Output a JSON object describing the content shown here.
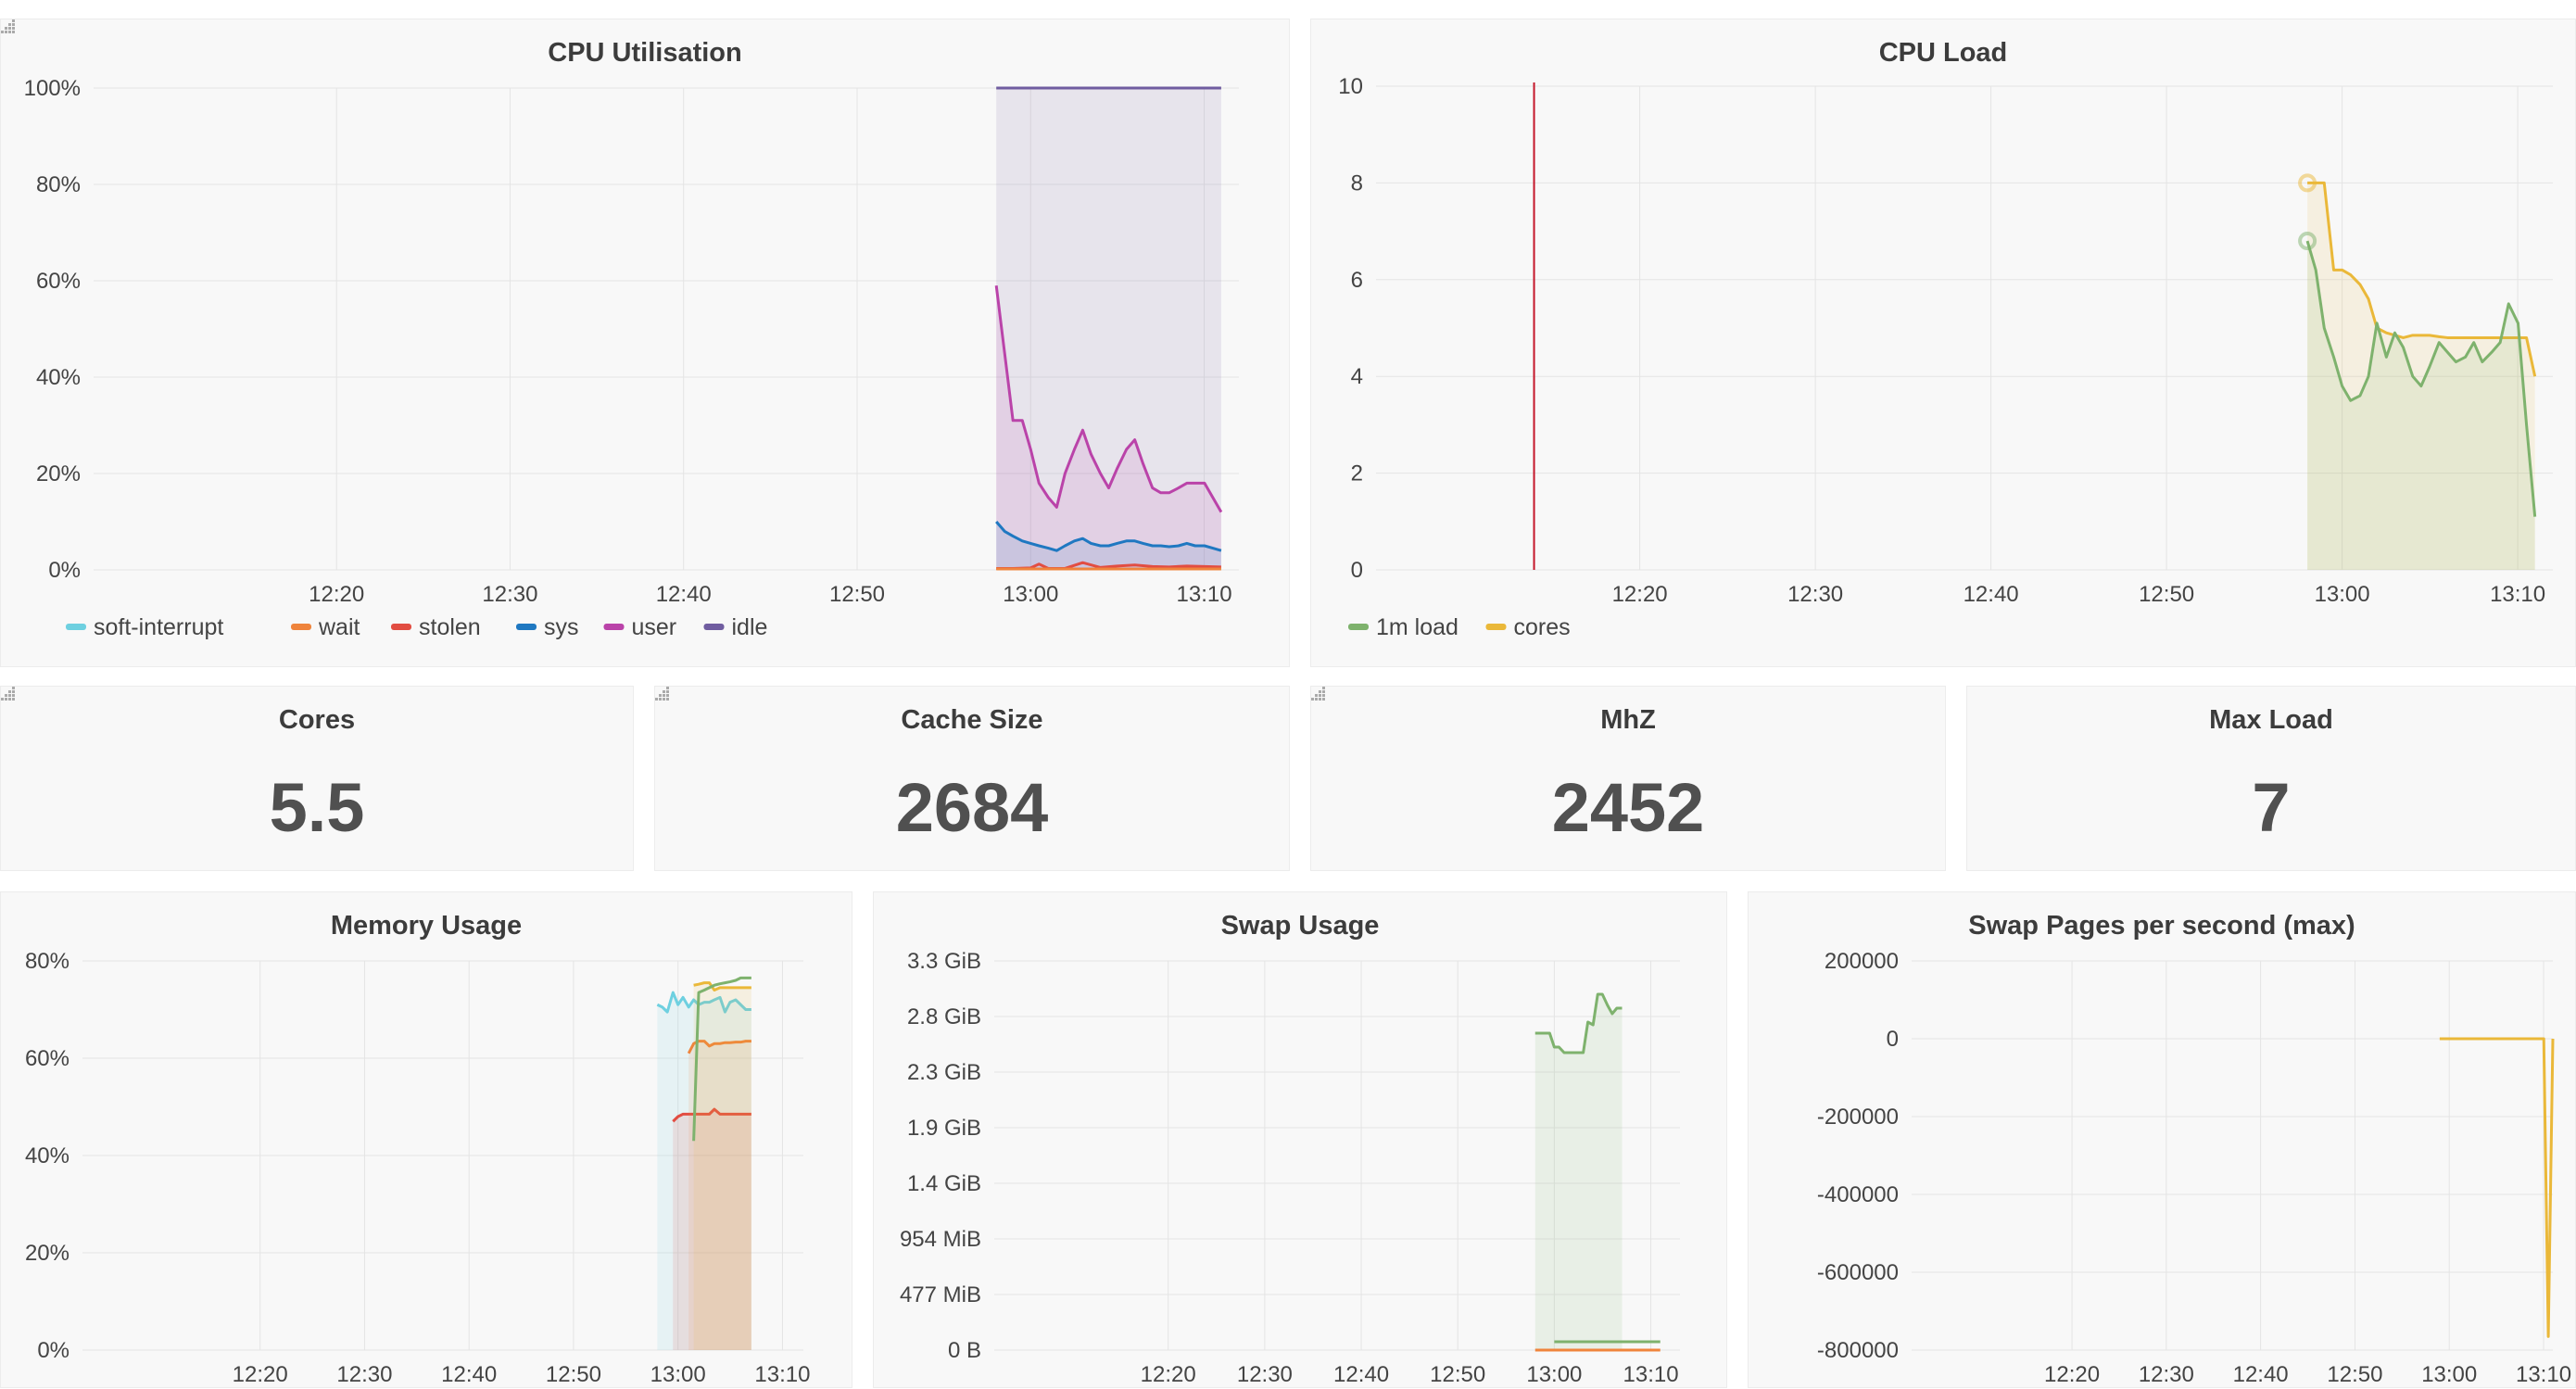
{
  "colors": {
    "soft_interrupt": "#6ed0e0",
    "wait": "#ef843c",
    "stolen": "#e24d42",
    "sys": "#1f78c1",
    "user": "#ba43a9",
    "idle": "#705da0",
    "load": "#7eb26d",
    "cores": "#eab839",
    "mem_cyan": "#6ed0e0",
    "mem_orange": "#ef843c",
    "mem_red": "#e24d42",
    "mem_yellow": "#eab839",
    "mem_green": "#7eb26d",
    "swap_green": "#7eb26d",
    "swap_orange": "#ef843c",
    "threshold_red": "#c4162a"
  },
  "panels": {
    "cpu_util": {
      "title": "CPU Utilisation"
    },
    "cpu_load": {
      "title": "CPU Load"
    },
    "cores": {
      "title": "Cores",
      "value": "5.5"
    },
    "cache": {
      "title": "Cache Size",
      "value": "2684"
    },
    "mhz": {
      "title": "MhZ",
      "value": "2452"
    },
    "maxload": {
      "title": "Max Load",
      "value": "7"
    },
    "memory": {
      "title": "Memory Usage"
    },
    "swap": {
      "title": "Swap Usage"
    },
    "swap_pages": {
      "title": "Swap Pages per second (max)"
    }
  },
  "chart_data": [
    {
      "id": "cpu_util",
      "type": "area",
      "title": "CPU Utilisation",
      "x_ticks": [
        "12:20",
        "12:30",
        "12:40",
        "12:50",
        "13:00",
        "13:10"
      ],
      "x_range": [
        12.1,
        13.2
      ],
      "y_ticks": [
        "0%",
        "20%",
        "40%",
        "60%",
        "80%",
        "100%"
      ],
      "ylim": [
        0,
        100
      ],
      "legend": [
        "soft-interrupt",
        "wait",
        "stolen",
        "sys",
        "user",
        "idle"
      ],
      "legend_position": "bottom-left",
      "grid": true,
      "series": [
        {
          "name": "idle",
          "color_key": "idle",
          "fill": true,
          "x": [
            12.967,
            13.183
          ],
          "values": [
            100,
            100
          ]
        },
        {
          "name": "user",
          "color_key": "user",
          "fill": true,
          "x": [
            12.967,
            12.975,
            12.983,
            12.992,
            13.0,
            13.008,
            13.017,
            13.025,
            13.033,
            13.042,
            13.05,
            13.058,
            13.067,
            13.075,
            13.083,
            13.092,
            13.1,
            13.108,
            13.117,
            13.125,
            13.133,
            13.142,
            13.15,
            13.158,
            13.167,
            13.175,
            13.183
          ],
          "values": [
            59,
            45,
            31,
            31,
            25,
            18,
            15,
            13,
            20,
            25,
            29,
            24,
            20,
            17,
            21,
            25,
            27,
            22,
            17,
            16,
            16,
            17,
            18,
            18,
            18,
            15,
            12
          ]
        },
        {
          "name": "sys",
          "color_key": "sys",
          "fill": true,
          "x": [
            12.967,
            12.975,
            12.983,
            12.992,
            13.0,
            13.008,
            13.017,
            13.025,
            13.033,
            13.042,
            13.05,
            13.058,
            13.067,
            13.075,
            13.083,
            13.092,
            13.1,
            13.108,
            13.117,
            13.125,
            13.133,
            13.142,
            13.15,
            13.158,
            13.167,
            13.175,
            13.183
          ],
          "values": [
            10,
            8,
            7,
            6,
            5.5,
            5,
            4.5,
            4,
            5,
            6,
            6.5,
            5.5,
            5,
            5,
            5.5,
            6,
            6,
            5.5,
            5,
            5,
            4.8,
            5,
            5.5,
            5,
            5,
            4.5,
            4
          ]
        },
        {
          "name": "stolen",
          "color_key": "stolen",
          "fill": false,
          "x": [
            12.967,
            12.983,
            13.0,
            13.008,
            13.017,
            13.033,
            13.05,
            13.067,
            13.083,
            13.1,
            13.117,
            13.133,
            13.15,
            13.167,
            13.183
          ],
          "values": [
            0.3,
            0.3,
            0.4,
            1.2,
            0.3,
            0.3,
            1.5,
            0.5,
            0.8,
            1.0,
            0.7,
            0.6,
            0.8,
            0.7,
            0.6
          ]
        },
        {
          "name": "wait",
          "color_key": "wait",
          "fill": false,
          "x": [
            12.967,
            13.183
          ],
          "values": [
            0.2,
            0.2
          ]
        }
      ]
    },
    {
      "id": "cpu_load",
      "type": "line",
      "title": "CPU Load",
      "x_ticks": [
        "12:20",
        "12:30",
        "12:40",
        "12:50",
        "13:00",
        "13:10"
      ],
      "x_range": [
        12.083,
        13.2
      ],
      "y_ticks": [
        "0",
        "2",
        "4",
        "6",
        "8",
        "10"
      ],
      "ylim": [
        0,
        10
      ],
      "legend": [
        "1m load",
        "cores"
      ],
      "legend_position": "bottom-left",
      "grid": true,
      "annotation_x": 12.233,
      "series": [
        {
          "name": "cores",
          "color_key": "cores",
          "fill": true,
          "x": [
            12.967,
            12.975,
            12.983,
            12.992,
            13.0,
            13.008,
            13.017,
            13.025,
            13.033,
            13.042,
            13.05,
            13.058,
            13.067,
            13.075,
            13.083,
            13.092,
            13.1,
            13.108,
            13.117,
            13.125,
            13.133,
            13.142,
            13.15,
            13.158,
            13.167,
            13.175,
            13.183
          ],
          "values": [
            8,
            8,
            8,
            6.2,
            6.2,
            6.1,
            5.9,
            5.6,
            5.0,
            4.9,
            4.85,
            4.8,
            4.85,
            4.85,
            4.85,
            4.82,
            4.8,
            4.8,
            4.8,
            4.8,
            4.8,
            4.8,
            4.8,
            4.8,
            4.8,
            4.8,
            4.0
          ]
        },
        {
          "name": "1m load",
          "color_key": "load",
          "fill": true,
          "x": [
            12.967,
            12.975,
            12.983,
            12.992,
            13.0,
            13.008,
            13.017,
            13.025,
            13.033,
            13.042,
            13.05,
            13.058,
            13.067,
            13.075,
            13.083,
            13.092,
            13.1,
            13.108,
            13.117,
            13.125,
            13.133,
            13.142,
            13.15,
            13.158,
            13.167,
            13.175,
            13.183
          ],
          "values": [
            6.8,
            6.2,
            5.0,
            4.4,
            3.8,
            3.5,
            3.6,
            4.0,
            5.1,
            4.4,
            4.9,
            4.6,
            4.0,
            3.8,
            4.2,
            4.7,
            4.5,
            4.3,
            4.4,
            4.7,
            4.3,
            4.5,
            4.7,
            5.5,
            5.1,
            3.0,
            1.1
          ]
        }
      ]
    },
    {
      "id": "memory",
      "type": "area",
      "title": "Memory Usage",
      "x_ticks": [
        "12:20",
        "12:30",
        "12:40",
        "12:50",
        "13:00",
        "13:10"
      ],
      "x_range": [
        12.05,
        13.2
      ],
      "y_ticks": [
        "0%",
        "20%",
        "40%",
        "60%",
        "80%"
      ],
      "ylim": [
        0,
        80
      ],
      "grid": true,
      "series": [
        {
          "color_key": "mem_cyan",
          "fill": true,
          "x": [
            12.967,
            12.975,
            12.983,
            12.992,
            13.0,
            13.008,
            13.017,
            13.025,
            13.033,
            13.042,
            13.05,
            13.058,
            13.067,
            13.075,
            13.083,
            13.092,
            13.1,
            13.108,
            13.117
          ],
          "values": [
            71,
            70.5,
            69.5,
            73.5,
            71,
            72.5,
            70.5,
            72,
            71,
            71.5,
            71.5,
            72,
            72.5,
            69.5,
            71.5,
            72,
            71,
            70,
            70
          ]
        },
        {
          "color_key": "mem_red",
          "fill": true,
          "x": [
            12.992,
            13.0,
            13.008,
            13.017,
            13.025,
            13.033,
            13.042,
            13.05,
            13.058,
            13.067,
            13.075,
            13.083,
            13.092,
            13.1,
            13.108,
            13.117
          ],
          "values": [
            47,
            48,
            48.5,
            48.5,
            48.5,
            48.5,
            48.5,
            48.5,
            49.5,
            48.5,
            48.5,
            48.5,
            48.5,
            48.5,
            48.5,
            48.5
          ]
        },
        {
          "color_key": "mem_orange",
          "fill": true,
          "x": [
            13.017,
            13.025,
            13.033,
            13.042,
            13.05,
            13.058,
            13.067,
            13.075,
            13.083,
            13.092,
            13.1,
            13.108,
            13.117
          ],
          "values": [
            61,
            63,
            63.5,
            63.5,
            62.5,
            63,
            63,
            63.2,
            63.2,
            63.3,
            63.3,
            63.5,
            63.5
          ]
        },
        {
          "color_key": "mem_yellow",
          "fill": true,
          "x": [
            13.025,
            13.033,
            13.042,
            13.05,
            13.058,
            13.067,
            13.075,
            13.083,
            13.092,
            13.1,
            13.108,
            13.117
          ],
          "values": [
            75,
            75.2,
            75.5,
            75.5,
            74,
            74.5,
            74.5,
            74.5,
            74.5,
            74.5,
            74.5,
            74.5
          ]
        },
        {
          "color_key": "mem_green",
          "fill": false,
          "x": [
            13.025,
            13.033,
            13.042,
            13.05,
            13.058,
            13.067,
            13.075,
            13.083,
            13.092,
            13.1,
            13.108,
            13.117
          ],
          "values": [
            43,
            73.5,
            74,
            74.5,
            75,
            75.3,
            75.5,
            75.7,
            76,
            76.5,
            76.5,
            76.5
          ]
        }
      ]
    },
    {
      "id": "swap",
      "type": "area",
      "title": "Swap Usage",
      "x_ticks": [
        "12:20",
        "12:30",
        "12:40",
        "12:50",
        "13:00",
        "13:10"
      ],
      "x_range": [
        12.033,
        13.217
      ],
      "y_ticks": [
        "0 B",
        "477 MiB",
        "954 MiB",
        "1.4 GiB",
        "1.9 GiB",
        "2.3 GiB",
        "2.8 GiB",
        "3.3 GiB"
      ],
      "ylim": [
        0,
        7
      ],
      "grid": true,
      "series": [
        {
          "color_key": "swap_green",
          "fill": true,
          "x": [
            12.967,
            12.975,
            12.983,
            12.992,
            13.0,
            13.008,
            13.017,
            13.025,
            13.033,
            13.042,
            13.05,
            13.058,
            13.067,
            13.075,
            13.083,
            13.092,
            13.1,
            13.108,
            13.117
          ],
          "values": [
            5.7,
            5.7,
            5.7,
            5.7,
            5.45,
            5.45,
            5.35,
            5.35,
            5.35,
            5.35,
            5.35,
            5.9,
            5.85,
            6.4,
            6.4,
            6.2,
            6.05,
            6.15,
            6.15
          ]
        },
        {
          "color_key": "swap_green",
          "fill": false,
          "x": [
            13.0,
            13.183
          ],
          "values": [
            0.15,
            0.15
          ]
        },
        {
          "color_key": "swap_orange",
          "fill": false,
          "x": [
            12.967,
            13.183
          ],
          "values": [
            0.0,
            0.0
          ]
        }
      ]
    },
    {
      "id": "swap_pages",
      "type": "line",
      "title": "Swap Pages per second (max)",
      "x_ticks": [
        "12:20",
        "12:30",
        "12:40",
        "12:50",
        "13:00",
        "13:10"
      ],
      "x_range": [
        12.05,
        13.183
      ],
      "y_ticks": [
        "-800000",
        "-600000",
        "-400000",
        "-200000",
        "0",
        "200000"
      ],
      "ylim": [
        -800000,
        200000
      ],
      "grid": true,
      "series": [
        {
          "color_key": "cores",
          "fill": false,
          "x": [
            12.983,
            13.0,
            13.017,
            13.033,
            13.05,
            13.067,
            13.083,
            13.1,
            13.117,
            13.125,
            13.167,
            13.175,
            13.183
          ],
          "values": [
            0,
            0,
            0,
            0,
            0,
            0,
            0,
            0,
            0,
            0,
            0,
            -765000,
            0
          ]
        }
      ]
    }
  ]
}
